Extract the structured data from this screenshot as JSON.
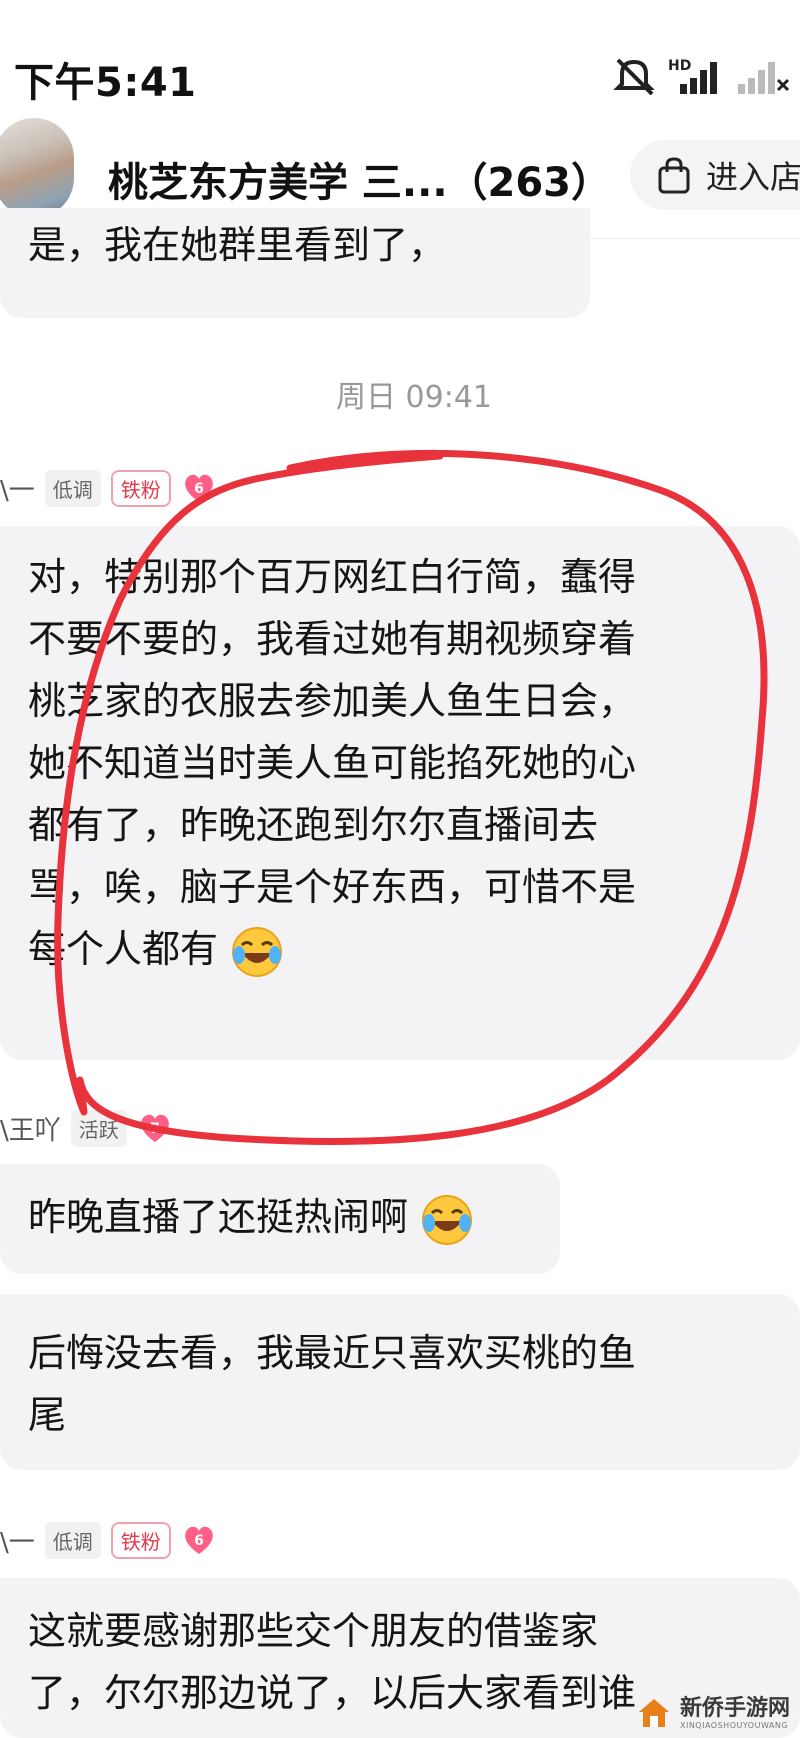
{
  "status_bar": {
    "time": "下午5:41"
  },
  "header": {
    "title": "桃芝东方美学 三...（263）",
    "enter_store": "进入店"
  },
  "messages": [
    {
      "text": "是，我在她群里看到了，",
      "type": "text"
    }
  ],
  "timestamp": "周日 09:41",
  "group1": {
    "nick": "\\一",
    "tag": "低调",
    "badge": "铁粉",
    "level": "6",
    "text": "对，特别那个百万网红白行简，蠢得不要不要的，我看过她有期视频穿着桃芝家的衣服去参加美人鱼生日会，她不知道当时美人鱼可能掐死她的心都有了，昨晚还跑到尔尔直播间去骂，唉，脑子是个好东西，可惜不是每个人都有",
    "lines": [
      "对，特别那个百万网红白行简，蠢得",
      "不要不要的，我看过她有期视频穿着",
      "桃芝家的衣服去参加美人鱼生日会，",
      "她不知道当时美人鱼可能掐死她的心",
      "都有了，昨晚还跑到尔尔直播间去",
      "骂，唉，脑子是个好东西，可惜不是",
      "每个人都有"
    ]
  },
  "group2": {
    "nick": "\\王吖",
    "tag": "活跃",
    "level": "7",
    "msg1": "昨晚直播了还挺热闹啊",
    "msg2_lines": [
      "后悔没去看，我最近只喜欢买桃的鱼",
      "尾"
    ]
  },
  "group3": {
    "nick": "\\一",
    "tag": "低调",
    "badge": "铁粉",
    "level": "6",
    "lines": [
      "这就要感谢那些交个朋友的借鉴家",
      "了，尔尔那边说了，以后大家看到谁"
    ]
  },
  "watermark": {
    "text": "新侨手游网",
    "subtext": "XINQIAOSHOUYOUWANG"
  },
  "colors": {
    "annotation_red": "#e8323c",
    "bubble_bg": "#f3f3f5",
    "badge_red": "#e23b4d"
  }
}
